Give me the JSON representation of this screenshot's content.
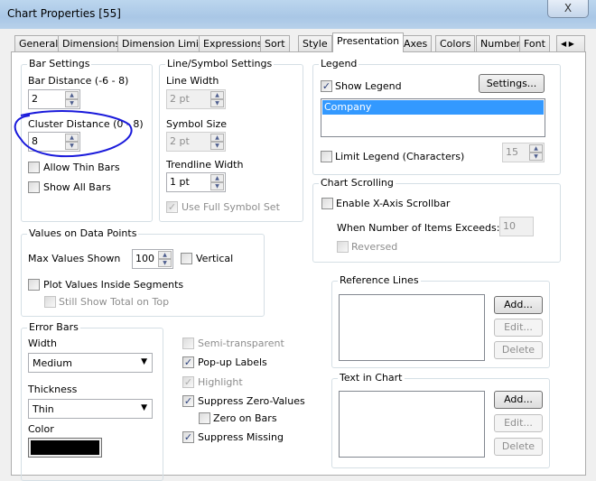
{
  "window": {
    "title": "Chart Properties [55]",
    "close_label": "X"
  },
  "tabs": [
    "General",
    "Dimensions",
    "Dimension Limits",
    "Expressions",
    "Sort",
    "Style",
    "Presentation",
    "Axes",
    "Colors",
    "Number",
    "Font"
  ],
  "active_tab": "Presentation",
  "bar_settings": {
    "title": "Bar Settings",
    "bar_distance_label": "Bar Distance (-6 - 8)",
    "bar_distance": "2",
    "cluster_distance_label": "Cluster Distance (0 - 8)",
    "cluster_distance": "8",
    "allow_thin_bars": "Allow Thin Bars",
    "show_all_bars": "Show All Bars",
    "annotation_color": "#1a1adb"
  },
  "line_symbol": {
    "title": "Line/Symbol Settings",
    "line_width_label": "Line Width",
    "line_width": "2 pt",
    "symbol_size_label": "Symbol Size",
    "symbol_size": "2 pt",
    "trendline_width_label": "Trendline Width",
    "trendline_width": "1 pt",
    "use_full_symbol_set": "Use Full Symbol Set"
  },
  "legend": {
    "title": "Legend",
    "show_legend": "Show Legend",
    "settings_button": "Settings...",
    "items": [
      "Company"
    ],
    "limit_legend": "Limit Legend (Characters)",
    "limit_value": "15",
    "selection_color": "#3399ff"
  },
  "chart_scrolling": {
    "title": "Chart Scrolling",
    "enable_scrollbar": "Enable X-Axis Scrollbar",
    "exceeds_label": "When Number of Items Exceeds:",
    "exceeds_value": "10",
    "reversed": "Reversed"
  },
  "values_on_points": {
    "title": "Values on Data Points",
    "max_values_label": "Max Values Shown",
    "max_values": "100",
    "vertical": "Vertical",
    "plot_inside": "Plot Values Inside Segments",
    "show_total": "Still Show Total on Top"
  },
  "error_bars": {
    "title": "Error Bars",
    "width_label": "Width",
    "width_value": "Medium",
    "thickness_label": "Thickness",
    "thickness_value": "Thin",
    "color_label": "Color",
    "color_value": "#000000"
  },
  "options": {
    "semi_transparent": "Semi-transparent",
    "popup_labels": "Pop-up Labels",
    "highlight": "Highlight",
    "suppress_zero": "Suppress Zero-Values",
    "zero_on_bars": "Zero on Bars",
    "suppress_missing": "Suppress Missing"
  },
  "reference_lines": {
    "title": "Reference Lines",
    "add": "Add...",
    "edit": "Edit...",
    "delete": "Delete"
  },
  "text_in_chart": {
    "title": "Text in Chart",
    "add": "Add...",
    "edit": "Edit...",
    "delete": "Delete"
  },
  "check_mark": "✓"
}
